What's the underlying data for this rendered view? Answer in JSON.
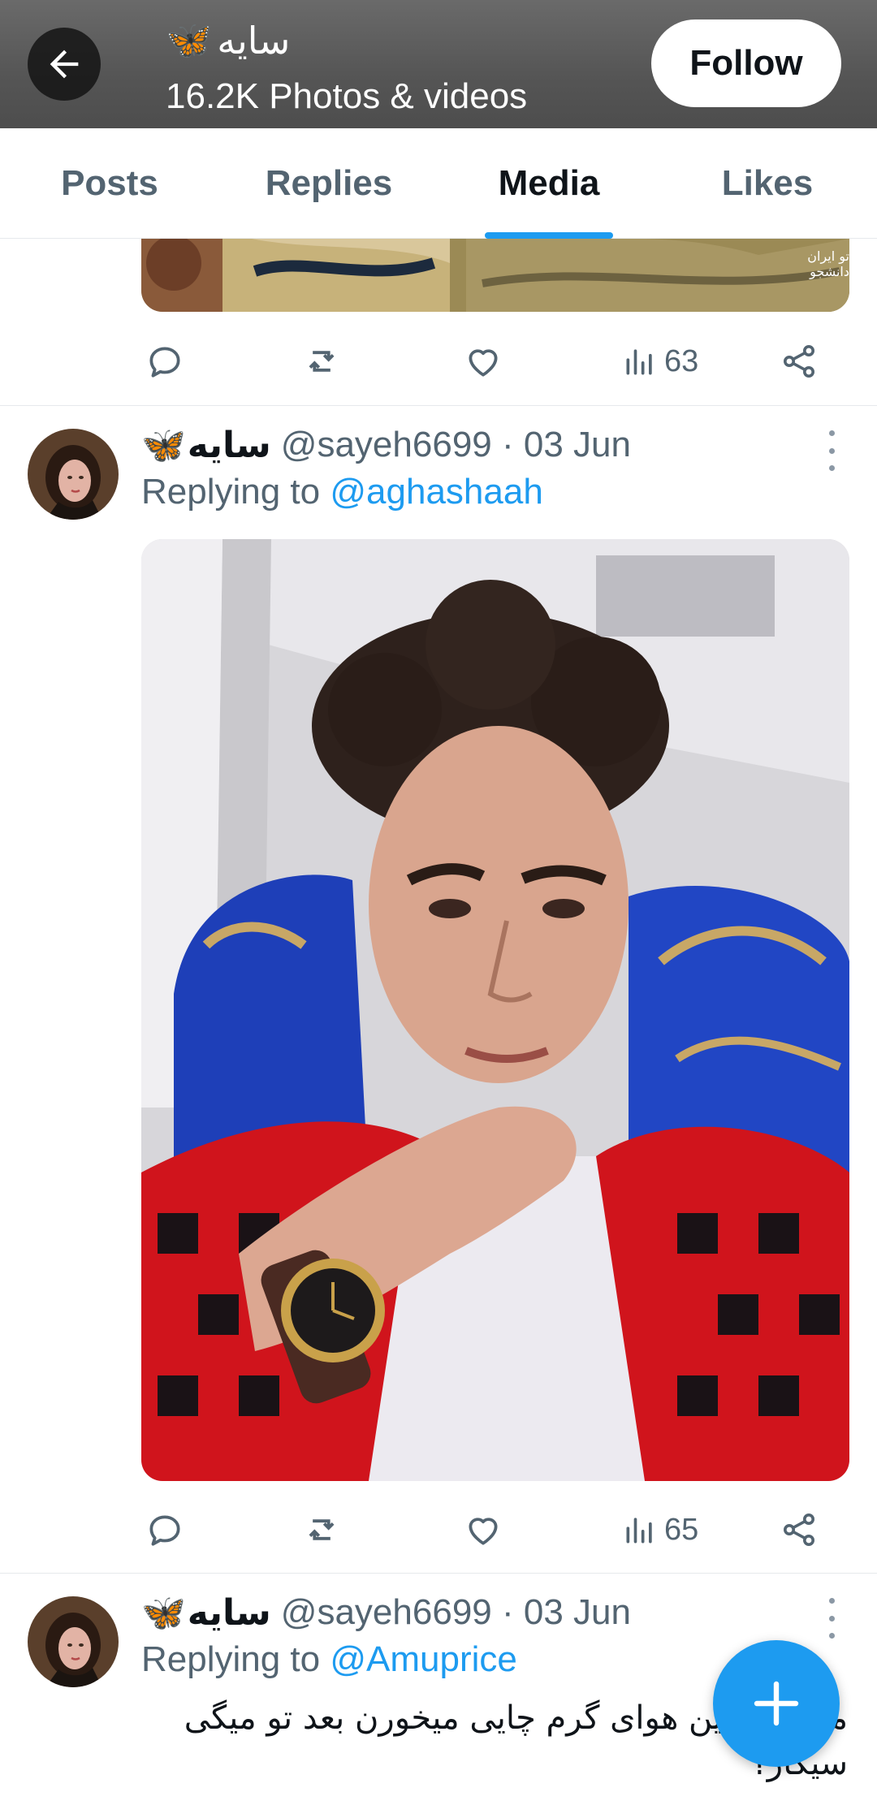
{
  "header": {
    "back_label": "Back",
    "name": "سایه",
    "name_emoji": "🦋",
    "subtitle": "16.2K Photos & videos",
    "follow_label": "Follow"
  },
  "tabs": [
    {
      "label": "Posts",
      "active": false
    },
    {
      "label": "Replies",
      "active": false
    },
    {
      "label": "Media",
      "active": true
    },
    {
      "label": "Likes",
      "active": false
    }
  ],
  "posts": [
    {
      "media_caption": "تو ایران دانشجو",
      "views": "63"
    },
    {
      "author_name": "سایه",
      "author_emoji": "🦋",
      "meta": "@sayeh6699 · 03 Jun",
      "replying_prefix": "Replying to ",
      "replying_to": "@aghashaah",
      "views": "65"
    },
    {
      "author_name": "سایه",
      "author_emoji": "🦋",
      "meta": "@sayeh6699 · 03 Jun",
      "replying_prefix": "Replying to ",
      "replying_to": "@Amuprice",
      "text": "مردم تو این هوای گرم چایی میخورن بعد تو میگی سیگار؟"
    }
  ],
  "colors": {
    "accent": "#1d9bf0",
    "muted": "#536471",
    "text": "#0f1419"
  },
  "icons": {
    "back": "arrow-left-icon",
    "reply": "reply-icon",
    "repost": "repost-icon",
    "like": "heart-icon",
    "views": "views-icon",
    "share": "share-icon",
    "more": "more-icon",
    "compose": "plus-icon"
  }
}
